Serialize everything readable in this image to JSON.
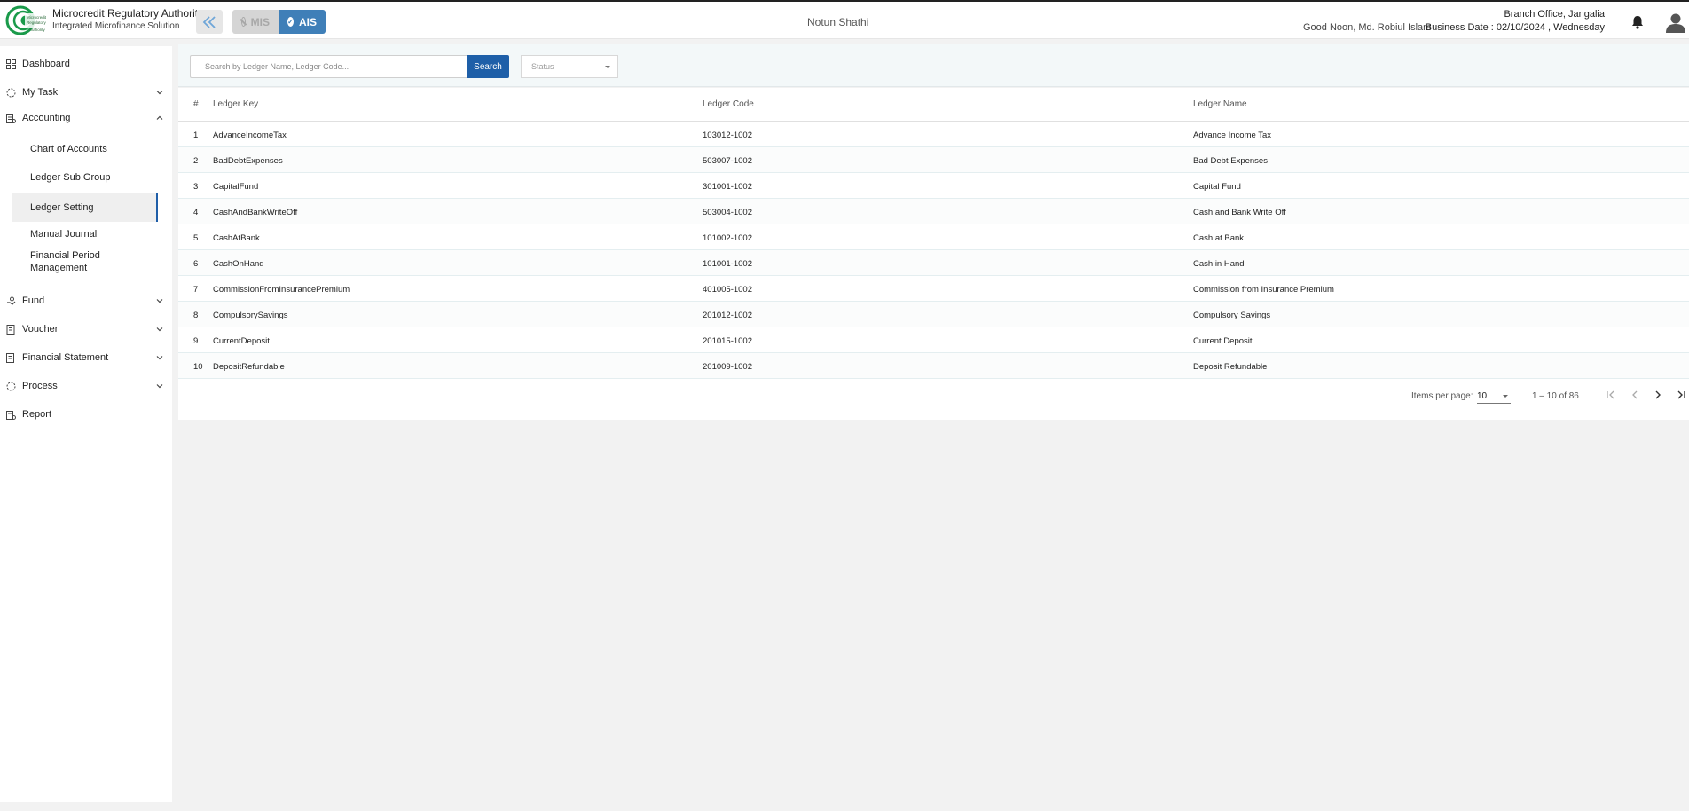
{
  "header": {
    "org_name": "Microcredit Regulatory Authority",
    "org_subtitle": "Integrated Microfinance Solution",
    "logo_text": "Microcredit Regulatory Authority",
    "mode_mis": "MIS",
    "mode_ais": "AIS",
    "app_name": "Notun Shathi",
    "greeting": "Good Noon, Md. Robiul Islam",
    "branch": "Branch Office, Jangalia",
    "business_date": "Business Date : 02/10/2024 , Wednesday"
  },
  "sidebar": {
    "items": [
      {
        "label": "Dashboard",
        "icon": "grid-icon"
      },
      {
        "label": "My Task",
        "icon": "task-icon"
      },
      {
        "label": "Accounting",
        "icon": "accounting-icon"
      },
      {
        "label": "Fund",
        "icon": "fund-icon"
      },
      {
        "label": "Voucher",
        "icon": "voucher-icon"
      },
      {
        "label": "Financial Statement",
        "icon": "statement-icon"
      },
      {
        "label": "Process",
        "icon": "process-icon"
      },
      {
        "label": "Report",
        "icon": "report-icon"
      }
    ],
    "accounting_sub": [
      {
        "label": "Chart of Accounts"
      },
      {
        "label": "Ledger Sub Group"
      },
      {
        "label": "Ledger Setting",
        "active": true
      },
      {
        "label": "Manual Journal"
      },
      {
        "label": "Financial Period Management"
      }
    ]
  },
  "filters": {
    "search_placeholder": "Search by Ledger Name, Ledger Code...",
    "search_button": "Search",
    "status_placeholder": "Status"
  },
  "table": {
    "columns": [
      "#",
      "Ledger Key",
      "Ledger Code",
      "Ledger Name"
    ],
    "rows": [
      {
        "num": "1",
        "key": "AdvanceIncomeTax",
        "code": "103012-1002",
        "name": "Advance Income Tax"
      },
      {
        "num": "2",
        "key": "BadDebtExpenses",
        "code": "503007-1002",
        "name": "Bad Debt Expenses"
      },
      {
        "num": "3",
        "key": "CapitalFund",
        "code": "301001-1002",
        "name": "Capital Fund"
      },
      {
        "num": "4",
        "key": "CashAndBankWriteOff",
        "code": "503004-1002",
        "name": "Cash and Bank Write Off"
      },
      {
        "num": "5",
        "key": "CashAtBank",
        "code": "101002-1002",
        "name": "Cash at Bank"
      },
      {
        "num": "6",
        "key": "CashOnHand",
        "code": "101001-1002",
        "name": "Cash in Hand"
      },
      {
        "num": "7",
        "key": "CommissionFromInsurancePremium",
        "code": "401005-1002",
        "name": "Commission from Insurance Premium"
      },
      {
        "num": "8",
        "key": "CompulsorySavings",
        "code": "201012-1002",
        "name": "Compulsory Savings"
      },
      {
        "num": "9",
        "key": "CurrentDeposit",
        "code": "201015-1002",
        "name": "Current Deposit"
      },
      {
        "num": "10",
        "key": "DepositRefundable",
        "code": "201009-1002",
        "name": "Deposit Refundable"
      }
    ]
  },
  "paginator": {
    "items_per_page_label": "Items per page:",
    "page_size": "10",
    "range": "1 – 10 of 86"
  },
  "colors": {
    "primary": "#1e5fa8",
    "ais_active": "#3f7fb8",
    "logo_green": "#1a9a4a"
  }
}
